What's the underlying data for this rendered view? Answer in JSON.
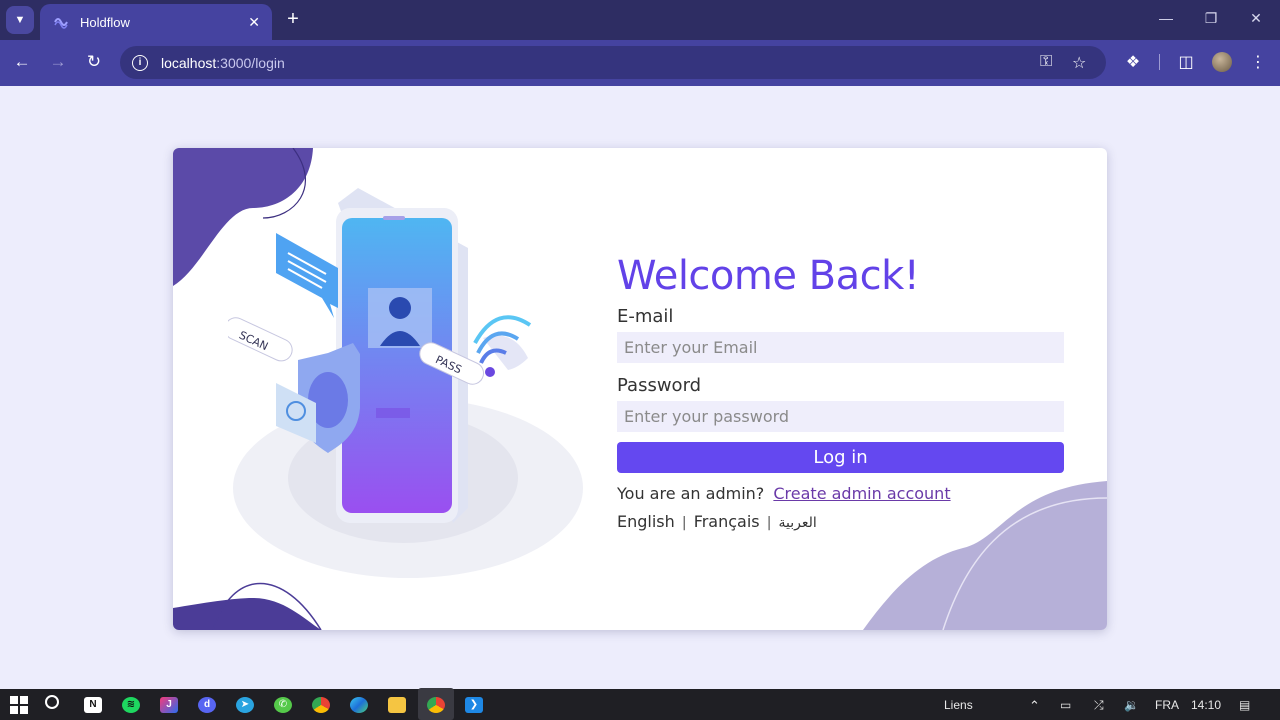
{
  "browser": {
    "tab_title": "Holdflow",
    "url_host": "localhost",
    "url_path": ":3000/login",
    "icons": [
      "tab-search-icon",
      "holdflow-favicon",
      "close-tab-icon",
      "new-tab-icon",
      "minimize-icon",
      "restore-icon",
      "close-window-icon",
      "back-icon",
      "forward-icon",
      "reload-icon",
      "site-info-icon",
      "password-key-icon",
      "bookmark-star-icon",
      "extensions-icon",
      "side-panel-icon",
      "profile-avatar",
      "kebab-menu-icon"
    ]
  },
  "login": {
    "title": "Welcome Back!",
    "email_label": "E-mail",
    "email_placeholder": "Enter your Email",
    "password_label": "Password",
    "password_placeholder": "Enter your password",
    "login_button": "Log in",
    "admin_prompt": "You are an admin?",
    "admin_link": "Create admin account",
    "languages": [
      "English",
      "Français",
      "العربية"
    ]
  },
  "illustration": {
    "labels": [
      "SCAN",
      "PASS"
    ]
  },
  "colors": {
    "accent": "#6448f0",
    "title": "#6242e8",
    "page_bg": "#ededfc",
    "chrome_dark": "#2e2d63",
    "chrome": "#4543a0"
  },
  "taskbar": {
    "apps": [
      "start-icon",
      "search-icon",
      "notion-icon",
      "spotify-icon",
      "jetbrains-icon",
      "discord-icon",
      "telegram-icon",
      "whatsapp-icon",
      "chrome-icon",
      "edge-icon",
      "file-explorer-icon",
      "chrome-active-icon",
      "vscode-icon"
    ],
    "links_label": "Liens",
    "language": "FRA",
    "time": "14:10"
  }
}
